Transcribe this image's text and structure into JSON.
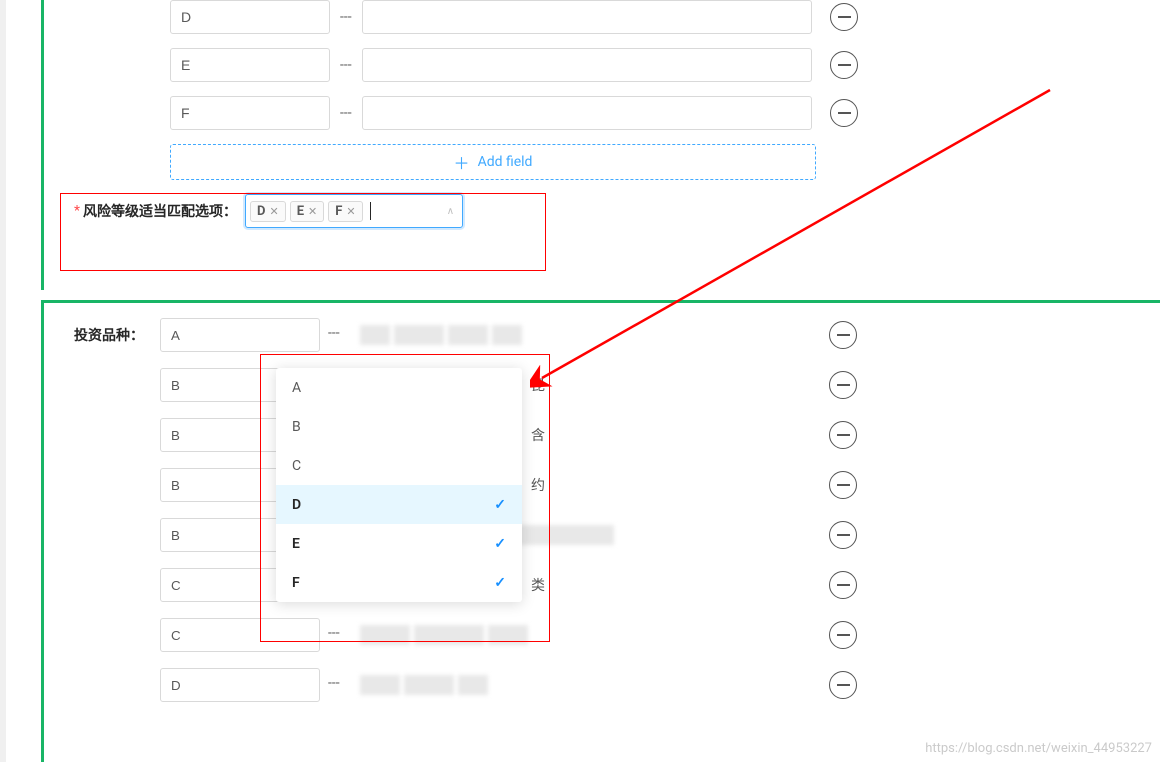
{
  "top_rows": [
    {
      "key": "D",
      "sep": "---"
    },
    {
      "key": "E",
      "sep": "---"
    },
    {
      "key": "F",
      "sep": "---"
    }
  ],
  "add_field_label": "Add field",
  "risk_match": {
    "label": "风险等级适当匹配选项：",
    "tags": [
      "D",
      "E",
      "F"
    ]
  },
  "invest_type": {
    "label": "投资品种：",
    "rows": [
      {
        "key": "A",
        "sep": "---"
      },
      {
        "key": "B",
        "sep": "---",
        "char": "昆"
      },
      {
        "key": "B",
        "sep": "---",
        "char": "含"
      },
      {
        "key": "B",
        "sep": "---",
        "char": "约"
      },
      {
        "key": "B",
        "sep": "---"
      },
      {
        "key": "C",
        "sep": "---",
        "char": "类"
      },
      {
        "key": "C",
        "sep": "---"
      },
      {
        "key": "D",
        "sep": "---"
      }
    ]
  },
  "dropdown": [
    {
      "label": "A",
      "checked": false
    },
    {
      "label": "B",
      "checked": false
    },
    {
      "label": "C",
      "checked": false
    },
    {
      "label": "D",
      "checked": true,
      "selected": true
    },
    {
      "label": "E",
      "checked": true
    },
    {
      "label": "F",
      "checked": true
    }
  ],
  "watermark": "https://blog.csdn.net/weixin_44953227"
}
